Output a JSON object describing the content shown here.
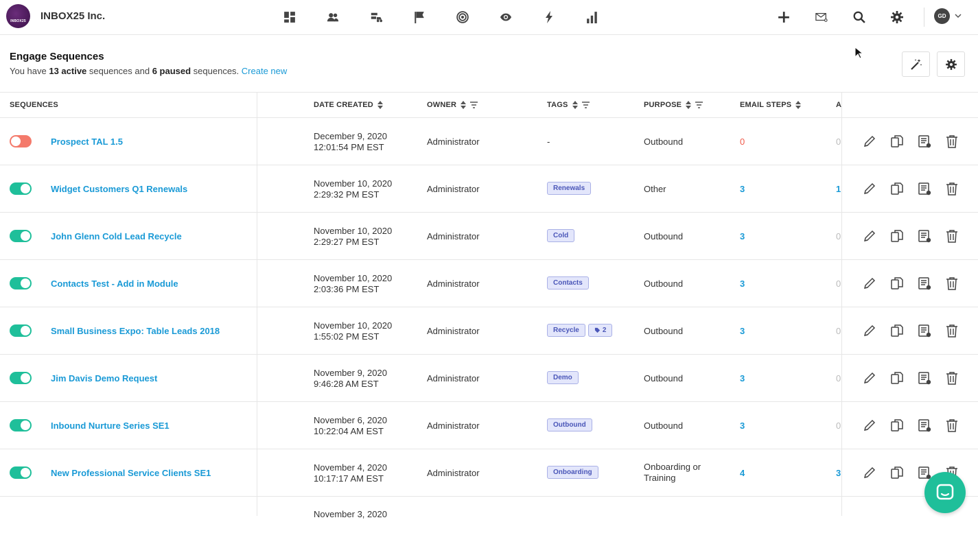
{
  "app": {
    "brand": "INBOX25 Inc.",
    "logo_text": "INBOX25",
    "nav_icons": [
      "dashboard-icon",
      "contacts-icon",
      "pipeline-icon",
      "flag-icon",
      "target-icon",
      "eye-icon",
      "lightning-icon",
      "bar-chart-icon"
    ],
    "right_icons": [
      "plus-icon",
      "mail-icon",
      "search-icon",
      "gear-icon"
    ],
    "avatar": "GD"
  },
  "header": {
    "title": "Engage Sequences",
    "sub_prefix": "You have ",
    "active_count": "13 active",
    "sub_mid": " sequences and ",
    "paused_count": "6 paused",
    "sub_suffix": " sequences. ",
    "create_link": "Create new"
  },
  "columns": {
    "sequences": "SEQUENCES",
    "date_created": "DATE CREATED",
    "owner": "OWNER",
    "tags": "TAGS",
    "purpose": "PURPOSE",
    "email_steps": "EMAIL STEPS",
    "clipped": "A"
  },
  "rows": [
    {
      "active": false,
      "name": "Prospect TAL 1.5",
      "date1": "December 9, 2020",
      "date2": "12:01:54 PM EST",
      "owner": "Administrator",
      "tags": [],
      "tag_text": "-",
      "purpose1": "Outbound",
      "purpose2": "",
      "steps": "0",
      "extra": "0"
    },
    {
      "active": true,
      "name": "Widget Customers Q1 Renewals",
      "date1": "November 10, 2020",
      "date2": "2:29:32 PM EST",
      "owner": "Administrator",
      "tags": [
        "Renewals"
      ],
      "tag_text": "",
      "purpose1": "Other",
      "purpose2": "",
      "steps": "3",
      "extra": "1"
    },
    {
      "active": true,
      "name": "John Glenn Cold Lead Recycle",
      "date1": "November 10, 2020",
      "date2": "2:29:27 PM EST",
      "owner": "Administrator",
      "tags": [
        "Cold"
      ],
      "tag_text": "",
      "purpose1": "Outbound",
      "purpose2": "",
      "steps": "3",
      "extra": "0"
    },
    {
      "active": true,
      "name": "Contacts Test - Add in Module",
      "date1": "November 10, 2020",
      "date2": "2:03:36 PM EST",
      "owner": "Administrator",
      "tags": [
        "Contacts"
      ],
      "tag_text": "",
      "purpose1": "Outbound",
      "purpose2": "",
      "steps": "3",
      "extra": "0"
    },
    {
      "active": true,
      "name": "Small Business Expo: Table Leads 2018",
      "date1": "November 10, 2020",
      "date2": "1:55:02 PM EST",
      "owner": "Administrator",
      "tags": [
        "Recycle"
      ],
      "more_tags": "2",
      "tag_text": "",
      "purpose1": "Outbound",
      "purpose2": "",
      "steps": "3",
      "extra": "0"
    },
    {
      "active": true,
      "name": "Jim Davis Demo Request",
      "date1": "November 9, 2020",
      "date2": "9:46:28 AM EST",
      "owner": "Administrator",
      "tags": [
        "Demo"
      ],
      "tag_text": "",
      "purpose1": "Outbound",
      "purpose2": "",
      "steps": "3",
      "extra": "0"
    },
    {
      "active": true,
      "name": "Inbound Nurture Series SE1",
      "date1": "November 6, 2020",
      "date2": "10:22:04 AM EST",
      "owner": "Administrator",
      "tags": [
        "Outbound"
      ],
      "tag_text": "",
      "purpose1": "Outbound",
      "purpose2": "",
      "steps": "3",
      "extra": "0"
    },
    {
      "active": true,
      "name": "New Professional Service Clients SE1",
      "date1": "November 4, 2020",
      "date2": "10:17:17 AM EST",
      "owner": "Administrator",
      "tags": [
        "Onboarding"
      ],
      "tag_text": "",
      "purpose1": "Onboarding or",
      "purpose2": "Training",
      "steps": "4",
      "extra": "3"
    }
  ],
  "partial_row": {
    "date1": "November 3, 2020"
  },
  "colors": {
    "accent": "#1a9ad6",
    "toggle_on": "#1fbf9a",
    "toggle_off": "#f47a6b",
    "zero": "#f05a4b",
    "tag_bg": "#e3e6fb"
  }
}
